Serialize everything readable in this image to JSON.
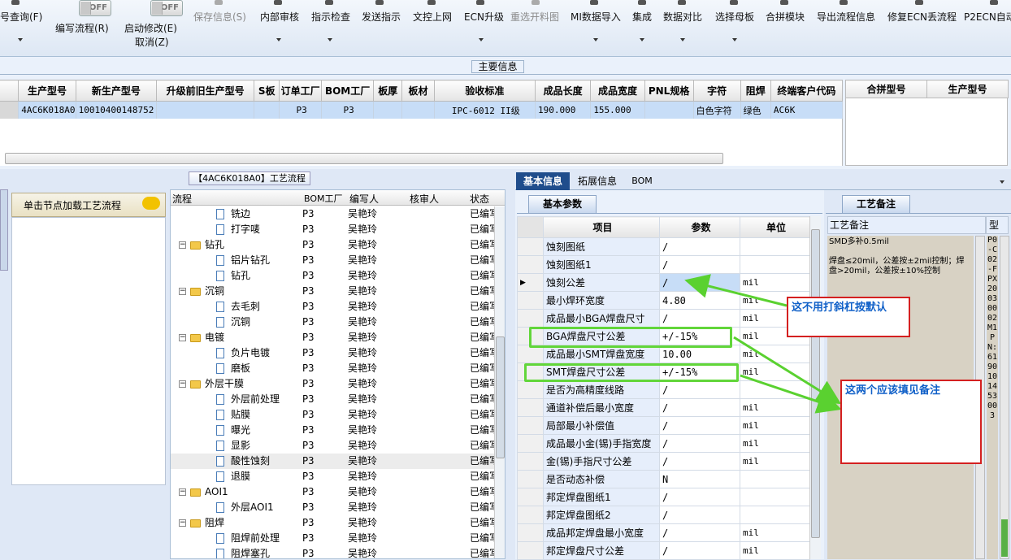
{
  "toolbar": {
    "items": [
      {
        "label": "号查询(F)",
        "disabled": false
      },
      {
        "label": "编写流程(R)",
        "disabled": false
      },
      {
        "label": "启动修改(E)",
        "disabled": false
      },
      {
        "label": "取消(Z)",
        "disabled": false
      },
      {
        "label": "保存信息(S)",
        "disabled": true
      },
      {
        "label": "内部审核",
        "disabled": false
      },
      {
        "label": "指示检查",
        "disabled": false
      },
      {
        "label": "发送指示",
        "disabled": false
      },
      {
        "label": "文控上网",
        "disabled": false
      },
      {
        "label": "ECN升级",
        "disabled": false
      },
      {
        "label": "重选开料图",
        "disabled": true
      },
      {
        "label": "MI数据导入",
        "disabled": false
      },
      {
        "label": "集成",
        "disabled": false
      },
      {
        "label": "数据对比",
        "disabled": false
      },
      {
        "label": "选择母板",
        "disabled": false
      },
      {
        "label": "合拼模块",
        "disabled": false
      },
      {
        "label": "导出流程信息",
        "disabled": false
      },
      {
        "label": "修复ECN丢流程",
        "disabled": false
      },
      {
        "label": "P2ECN自动",
        "disabled": false
      }
    ],
    "toggle_off": "OFF"
  },
  "main_info": {
    "group_title": "主要信息",
    "columns": [
      "生产型号",
      "新生产型号",
      "升级前旧生产型号",
      "S板",
      "订单工厂",
      "BOM工厂",
      "板厚",
      "板材",
      "验收标准",
      "成品长度",
      "成品宽度",
      "PNL规格",
      "字符",
      "阻焊",
      "终端客户代码"
    ],
    "row": [
      "4AC6K018A0",
      "10010400148752",
      "",
      "",
      "P3",
      "P3",
      "",
      "",
      "IPC-6012 II级",
      "190.000",
      "155.000",
      "",
      "白色字符",
      "绿色",
      "AC6K"
    ],
    "merge_columns": [
      "合拼型号",
      "生产型号"
    ]
  },
  "process": {
    "title": "【4AC6K018A0】工艺流程",
    "left_hint": "单击节点加载工艺流程",
    "columns": [
      "流程",
      "BOM工厂",
      "编写人",
      "核审人",
      "状态"
    ],
    "rows": [
      {
        "name": "铣边",
        "level": 1,
        "folder": false,
        "bom": "P3",
        "writer": "吴艳玲",
        "status": "已编写"
      },
      {
        "name": "打字唛",
        "level": 1,
        "folder": false,
        "bom": "P3",
        "writer": "吴艳玲",
        "status": "已编写"
      },
      {
        "name": "钻孔",
        "level": 0,
        "folder": true,
        "bom": "P3",
        "writer": "吴艳玲",
        "status": "已编写"
      },
      {
        "name": "铝片钻孔",
        "level": 1,
        "folder": false,
        "bom": "P3",
        "writer": "吴艳玲",
        "status": "已编写"
      },
      {
        "name": "钻孔",
        "level": 1,
        "folder": false,
        "bom": "P3",
        "writer": "吴艳玲",
        "status": "已编写"
      },
      {
        "name": "沉铜",
        "level": 0,
        "folder": true,
        "bom": "P3",
        "writer": "吴艳玲",
        "status": "已编写"
      },
      {
        "name": "去毛刺",
        "level": 1,
        "folder": false,
        "bom": "P3",
        "writer": "吴艳玲",
        "status": "已编写"
      },
      {
        "name": "沉铜",
        "level": 1,
        "folder": false,
        "bom": "P3",
        "writer": "吴艳玲",
        "status": "已编写"
      },
      {
        "name": "电镀",
        "level": 0,
        "folder": true,
        "bom": "P3",
        "writer": "吴艳玲",
        "status": "已编写"
      },
      {
        "name": "负片电镀",
        "level": 1,
        "folder": false,
        "bom": "P3",
        "writer": "吴艳玲",
        "status": "已编写"
      },
      {
        "name": "磨板",
        "level": 1,
        "folder": false,
        "bom": "P3",
        "writer": "吴艳玲",
        "status": "已编写"
      },
      {
        "name": "外层干膜",
        "level": 0,
        "folder": true,
        "bom": "P3",
        "writer": "吴艳玲",
        "status": "已编写"
      },
      {
        "name": "外层前处理",
        "level": 1,
        "folder": false,
        "bom": "P3",
        "writer": "吴艳玲",
        "status": "已编写"
      },
      {
        "name": "贴膜",
        "level": 1,
        "folder": false,
        "bom": "P3",
        "writer": "吴艳玲",
        "status": "已编写"
      },
      {
        "name": "曝光",
        "level": 1,
        "folder": false,
        "bom": "P3",
        "writer": "吴艳玲",
        "status": "已编写"
      },
      {
        "name": "显影",
        "level": 1,
        "folder": false,
        "bom": "P3",
        "writer": "吴艳玲",
        "status": "已编写"
      },
      {
        "name": "酸性蚀刻",
        "level": 1,
        "folder": false,
        "bom": "P3",
        "writer": "吴艳玲",
        "status": "已编写",
        "selected": true
      },
      {
        "name": "退膜",
        "level": 1,
        "folder": false,
        "bom": "P3",
        "writer": "吴艳玲",
        "status": "已编写"
      },
      {
        "name": "AOI1",
        "level": 0,
        "folder": true,
        "bom": "P3",
        "writer": "吴艳玲",
        "status": "已编写"
      },
      {
        "name": "外层AOI1",
        "level": 1,
        "folder": false,
        "bom": "P3",
        "writer": "吴艳玲",
        "status": "已编写"
      },
      {
        "name": "阻焊",
        "level": 0,
        "folder": true,
        "bom": "P3",
        "writer": "吴艳玲",
        "status": "已编写"
      },
      {
        "name": "阻焊前处理",
        "level": 1,
        "folder": false,
        "bom": "P3",
        "writer": "吴艳玲",
        "status": "已编写"
      },
      {
        "name": "阻焊塞孔",
        "level": 1,
        "folder": false,
        "bom": "P3",
        "writer": "吴艳玲",
        "status": "已编写"
      }
    ]
  },
  "params": {
    "tabs": [
      "基本信息",
      "拓展信息",
      "BOM"
    ],
    "sub_tab": "基本参数",
    "columns": [
      "项目",
      "参数",
      "单位"
    ],
    "rows": [
      {
        "item": "蚀刻图纸",
        "value": "/",
        "unit": ""
      },
      {
        "item": "蚀刻图纸1",
        "value": "/",
        "unit": ""
      },
      {
        "item": "蚀刻公差",
        "value": "/",
        "unit": "mil",
        "current": true
      },
      {
        "item": "最小焊环宽度",
        "value": "4.80",
        "unit": "mil"
      },
      {
        "item": "成品最小BGA焊盘尺寸",
        "value": "/",
        "unit": "mil"
      },
      {
        "item": "BGA焊盘尺寸公差",
        "value": "+/-15%",
        "unit": "mil"
      },
      {
        "item": "成品最小SMT焊盘宽度",
        "value": "10.00",
        "unit": "mil"
      },
      {
        "item": "SMT焊盘尺寸公差",
        "value": "+/-15%",
        "unit": "mil"
      },
      {
        "item": "是否为高精度线路",
        "value": "/",
        "unit": ""
      },
      {
        "item": "通道补偿后最小宽度",
        "value": "/",
        "unit": "mil"
      },
      {
        "item": "局部最小补偿值",
        "value": "/",
        "unit": "mil"
      },
      {
        "item": "成品最小金(锡)手指宽度",
        "value": "/",
        "unit": "mil"
      },
      {
        "item": "金(锡)手指尺寸公差",
        "value": "/",
        "unit": "mil"
      },
      {
        "item": "是否动态补偿",
        "value": "N",
        "unit": ""
      },
      {
        "item": "邦定焊盘图纸1",
        "value": "/",
        "unit": ""
      },
      {
        "item": "邦定焊盘图纸2",
        "value": "/",
        "unit": ""
      },
      {
        "item": "成品邦定焊盘最小宽度",
        "value": "/",
        "unit": "mil"
      },
      {
        "item": "邦定焊盘尺寸公差",
        "value": "/",
        "unit": "mil"
      }
    ]
  },
  "remarks": {
    "tab": "工艺备注",
    "header": "工艺备注",
    "type_header": "型",
    "line1": "SMD多补0.5mil",
    "line2": "焊盘≤20mil，公差按±2mil控制；焊盘>20mil，公差按±10%控制",
    "vertical_text": "P0-C02-FPX20030002M1PN:6190101453003"
  },
  "annotations": {
    "note1": "这不用打斜杠按默认",
    "note2": "这两个应该填见备注"
  },
  "colors": {
    "highlight": "#62d63a",
    "note_border": "#d42020",
    "note_text": "#1060c8",
    "selection": "#c7ddf7"
  }
}
